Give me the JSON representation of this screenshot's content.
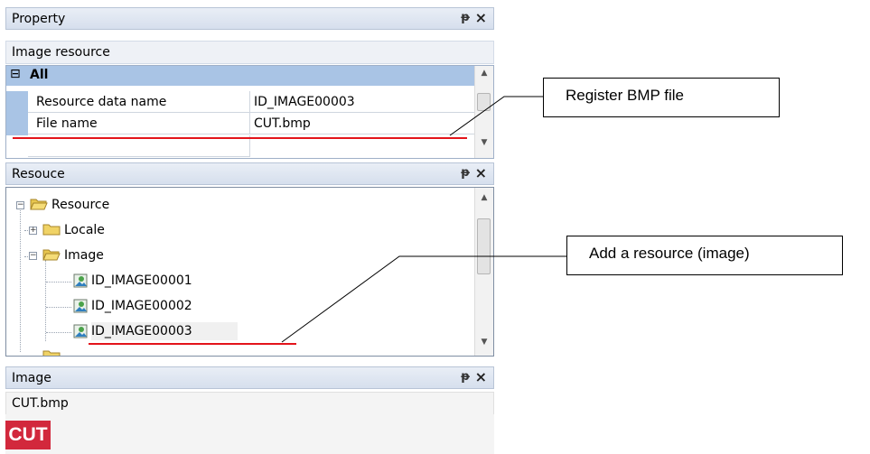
{
  "property_panel": {
    "title": "Property",
    "pin_icon": "ᵽ",
    "close_icon": "×",
    "subtitle": "Image resource",
    "group_label": "All",
    "rows": [
      {
        "name": "Resource data name",
        "value": "ID_IMAGE00003"
      },
      {
        "name": "File name",
        "value": "CUT.bmp"
      }
    ]
  },
  "resource_panel": {
    "title": "Resouce",
    "tree": {
      "root": "Resource",
      "locale": "Locale",
      "image": "Image",
      "items": [
        "ID_IMAGE00001",
        "ID_IMAGE00002",
        "ID_IMAGE00003"
      ]
    }
  },
  "image_panel": {
    "title": "Image",
    "filename": "CUT.bmp",
    "preview_text": "CUT"
  },
  "callouts": {
    "register": "Register BMP file",
    "add": "Add a resource (image)"
  },
  "colors": {
    "accent_red": "#e3141b",
    "header_blue": "#a9c4e5"
  }
}
